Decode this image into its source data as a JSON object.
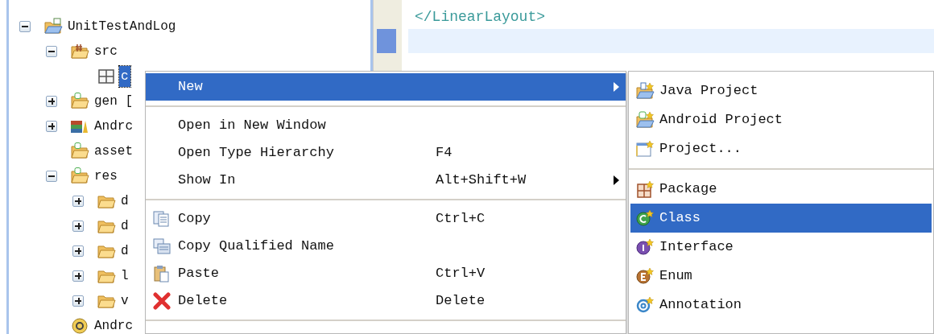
{
  "tree": [
    {
      "label": "UnitTestAndLog",
      "kind": "project",
      "expanded": true,
      "selected": false,
      "children": [
        {
          "label": "src",
          "kind": "source-folder",
          "expanded": true,
          "selected": false,
          "children": [
            {
              "label": "c",
              "kind": "package",
              "selected": true
            }
          ]
        },
        {
          "label": "gen [",
          "kind": "android-folder",
          "expanded": false,
          "selected": false
        },
        {
          "label": "Andrc",
          "kind": "library",
          "expanded": false,
          "selected": false
        },
        {
          "label": "asset",
          "kind": "android-folder",
          "selected": false
        },
        {
          "label": "res",
          "kind": "android-folder",
          "expanded": true,
          "selected": false,
          "children": [
            {
              "label": "d",
              "kind": "folder",
              "expanded": false,
              "selected": false
            },
            {
              "label": "d",
              "kind": "folder",
              "expanded": false,
              "selected": false
            },
            {
              "label": "d",
              "kind": "folder",
              "expanded": false,
              "selected": false
            },
            {
              "label": "l",
              "kind": "folder",
              "expanded": false,
              "selected": false
            },
            {
              "label": "v",
              "kind": "folder",
              "expanded": false,
              "selected": false
            }
          ]
        },
        {
          "label": "Andrc",
          "kind": "manifest",
          "selected": false
        }
      ]
    }
  ],
  "editor": {
    "lines": [
      "</LinearLayout>"
    ]
  },
  "context_menu": [
    {
      "kind": "plain",
      "label": "New",
      "submenu": true,
      "selected": true
    },
    {
      "kind": "separator"
    },
    {
      "kind": "plain",
      "label": "Open in New Window",
      "submenu": false,
      "selected": false
    },
    {
      "kind": "plain",
      "label": "Open Type Hierarchy",
      "shortcut": "F4",
      "submenu": false,
      "selected": false
    },
    {
      "kind": "plain",
      "label": "Show In",
      "shortcut": "Alt+Shift+W",
      "submenu": true,
      "selected": false
    },
    {
      "kind": "separator"
    },
    {
      "kind": "copy",
      "label": "Copy",
      "shortcut": "Ctrl+C",
      "submenu": false,
      "selected": false
    },
    {
      "kind": "copy-qualified",
      "label": "Copy Qualified Name",
      "submenu": false,
      "selected": false
    },
    {
      "kind": "paste",
      "label": "Paste",
      "shortcut": "Ctrl+V",
      "submenu": false,
      "selected": false
    },
    {
      "kind": "delete",
      "label": "Delete",
      "shortcut": "Delete",
      "submenu": false,
      "selected": false
    },
    {
      "kind": "separator"
    }
  ],
  "new_submenu": [
    {
      "kind": "java-project",
      "label": "Java Project",
      "selected": false
    },
    {
      "kind": "android-project",
      "label": "Android Project",
      "selected": false
    },
    {
      "kind": "project-wizard",
      "label": "Project...",
      "selected": false
    },
    {
      "kind": "separator"
    },
    {
      "kind": "new-package",
      "label": "Package",
      "selected": false
    },
    {
      "kind": "class",
      "label": "Class",
      "selected": true
    },
    {
      "kind": "interface",
      "label": "Interface",
      "selected": false
    },
    {
      "kind": "enum",
      "label": "Enum",
      "selected": false
    },
    {
      "kind": "annotation",
      "label": "Annotation",
      "selected": false
    }
  ]
}
